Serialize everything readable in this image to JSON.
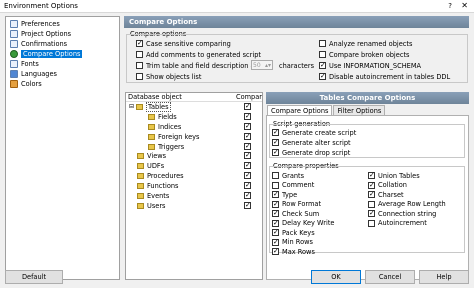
{
  "window": {
    "title": "Environment Options",
    "help_glyph": "?",
    "close_glyph": "✕"
  },
  "nav": {
    "items": [
      {
        "label": "Preferences",
        "icon": "preferences-icon",
        "selected": false
      },
      {
        "label": "Project Options",
        "icon": "project-icon",
        "selected": false
      },
      {
        "label": "Confirmations",
        "icon": "confirm-icon",
        "selected": false
      },
      {
        "label": "Compare Options",
        "icon": "compare-icon",
        "selected": true
      },
      {
        "label": "Fonts",
        "icon": "fonts-icon",
        "selected": false
      },
      {
        "label": "Languages",
        "icon": "languages-icon",
        "selected": false
      },
      {
        "label": "Colors",
        "icon": "colors-icon",
        "selected": false
      }
    ]
  },
  "compare": {
    "header": "Compare Options",
    "group_label": "Compare options",
    "left_options": [
      {
        "label": "Case sensitive comparing",
        "checked": true
      },
      {
        "label": "Add comments to generated script",
        "checked": false
      },
      {
        "label": "Trim table and field description after",
        "checked": false
      },
      {
        "label": "Show objects list",
        "checked": false
      }
    ],
    "trim_value": "50",
    "trim_suffix": "characters",
    "right_options": [
      {
        "label": "Analyze renamed objects",
        "checked": false
      },
      {
        "label": "Compare broken objects",
        "checked": false
      },
      {
        "label": "Use INFORMATION_SCHEMA",
        "checked": true
      },
      {
        "label": "Disable autoincrement in tables DDL",
        "checked": true
      }
    ]
  },
  "tree": {
    "col_object": "Database object",
    "col_compare": "Compare",
    "rows": [
      {
        "label": "Tables",
        "level": 0,
        "checked": true,
        "expanded": true
      },
      {
        "label": "Fields",
        "level": 1,
        "checked": true
      },
      {
        "label": "Indices",
        "level": 1,
        "checked": true
      },
      {
        "label": "Foreign keys",
        "level": 1,
        "checked": true
      },
      {
        "label": "Triggers",
        "level": 1,
        "checked": true
      },
      {
        "label": "Views",
        "level": 0,
        "checked": true
      },
      {
        "label": "UDFs",
        "level": 0,
        "checked": true
      },
      {
        "label": "Procedures",
        "level": 0,
        "checked": true
      },
      {
        "label": "Functions",
        "level": 0,
        "checked": true
      },
      {
        "label": "Events",
        "level": 0,
        "checked": true
      },
      {
        "label": "Users",
        "level": 0,
        "checked": true
      }
    ]
  },
  "table_options": {
    "header": "Tables Compare Options",
    "tabs": [
      "Compare Options",
      "Filter Options"
    ],
    "script_group_label": "Script generation",
    "script_options": [
      {
        "label": "Generate create script",
        "checked": true
      },
      {
        "label": "Generate alter script",
        "checked": true
      },
      {
        "label": "Generate drop script",
        "checked": true
      }
    ],
    "props_group_label": "Compare properties",
    "props_left": [
      {
        "label": "Grants",
        "checked": false
      },
      {
        "label": "Comment",
        "checked": false
      },
      {
        "label": "Type",
        "checked": true
      },
      {
        "label": "Row Format",
        "checked": true
      },
      {
        "label": "Check Sum",
        "checked": true
      },
      {
        "label": "Delay Key Write",
        "checked": true
      },
      {
        "label": "Pack Keys",
        "checked": true
      },
      {
        "label": "Min Rows",
        "checked": true
      },
      {
        "label": "Max Rows",
        "checked": true
      }
    ],
    "props_right": [
      {
        "label": "Union Tables",
        "checked": true
      },
      {
        "label": "Collation",
        "checked": true
      },
      {
        "label": "Charset",
        "checked": true
      },
      {
        "label": "Average Row Length",
        "checked": false
      },
      {
        "label": "Connection string",
        "checked": true
      },
      {
        "label": "Autoincrement",
        "checked": false
      }
    ]
  },
  "buttons": {
    "default": "Default",
    "ok": "OK",
    "cancel": "Cancel",
    "help": "Help"
  }
}
